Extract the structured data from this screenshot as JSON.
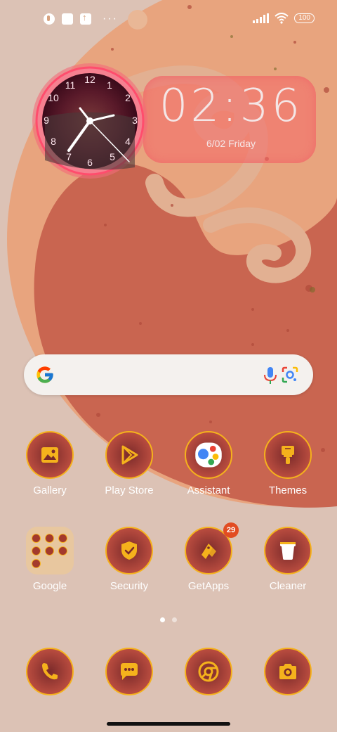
{
  "status_bar": {
    "left_icons": [
      "notification-icon",
      "square-icon",
      "upload-icon",
      "more-dots-icon"
    ],
    "dots": "···",
    "battery": "100"
  },
  "clock_widget": {
    "time": "02:36",
    "date": "6/02 Friday",
    "dial_numbers": [
      "12",
      "1",
      "2",
      "3",
      "4",
      "5",
      "6",
      "7",
      "8",
      "9",
      "10",
      "11"
    ]
  },
  "search_bar": {
    "icons": [
      "google-g-icon",
      "mic-icon",
      "lens-icon"
    ]
  },
  "apps_row1": [
    {
      "label": "Gallery",
      "icon": "gallery-icon"
    },
    {
      "label": "Play Store",
      "icon": "play-store-icon"
    },
    {
      "label": "Assistant",
      "icon": "assistant-icon"
    },
    {
      "label": "Themes",
      "icon": "themes-icon"
    }
  ],
  "apps_row2": [
    {
      "label": "Google",
      "icon": "folder-icon"
    },
    {
      "label": "Security",
      "icon": "security-icon"
    },
    {
      "label": "GetApps",
      "icon": "getapps-icon",
      "badge": "29"
    },
    {
      "label": "Cleaner",
      "icon": "cleaner-icon"
    }
  ],
  "dock": [
    {
      "icon": "phone-icon"
    },
    {
      "icon": "messages-icon"
    },
    {
      "icon": "chrome-icon"
    },
    {
      "icon": "camera-icon"
    }
  ],
  "colors": {
    "accent": "#f5b21c",
    "wallpaper_bg": "#dcc2b5",
    "blob_outer": "#e8a47e",
    "blob_inner": "#c96550"
  }
}
